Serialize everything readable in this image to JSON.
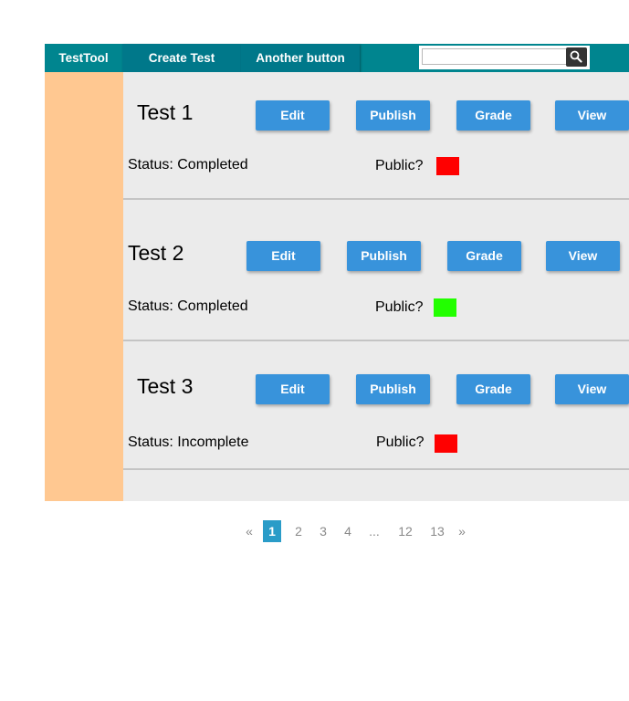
{
  "nav": {
    "brand": "TestTool",
    "create_test": "Create Test",
    "another_button": "Another button",
    "search": {
      "value": "",
      "placeholder": ""
    }
  },
  "tests": [
    {
      "title": "Test 1",
      "status": "Status: Completed",
      "public_label": "Public?",
      "public_color": "#ff0000",
      "buttons": [
        "Edit",
        "Publish",
        "Grade",
        "View"
      ]
    },
    {
      "title": "Test 2",
      "status": "Status: Completed",
      "public_label": "Public?",
      "public_color": "#22ff00",
      "buttons": [
        "Edit",
        "Publish",
        "Grade",
        "View"
      ]
    },
    {
      "title": "Test 3",
      "status": "Status: Incomplete",
      "public_label": "Public?",
      "public_color": "#ff0000",
      "buttons": [
        "Edit",
        "Publish",
        "Grade",
        "View"
      ]
    }
  ],
  "pagination": {
    "prev": "«",
    "pages": [
      "1",
      "2",
      "3",
      "4",
      "...",
      "12",
      "13"
    ],
    "current": "1",
    "next": "»"
  },
  "colors": {
    "navbar": "#00858f",
    "button": "#3893db",
    "sidebar": "#ffc891",
    "pager_active": "#2a9cc8"
  }
}
